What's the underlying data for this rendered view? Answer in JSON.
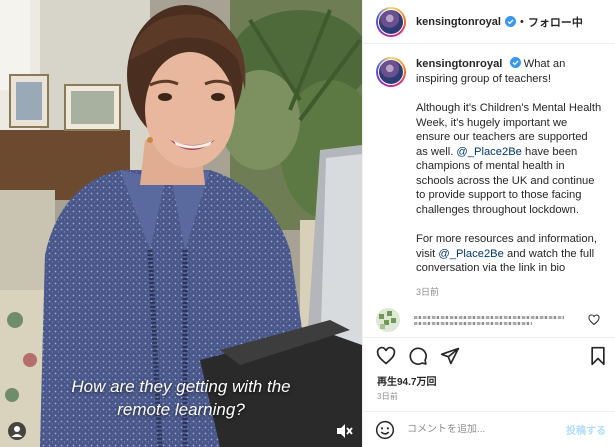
{
  "header": {
    "username": "kensingtonroyal",
    "separator": "•",
    "follow_label": "フォロー中"
  },
  "video": {
    "subtitle_line1": "How are they getting with the",
    "subtitle_line2": "remote learning?"
  },
  "caption": {
    "username": "kensingtonroyal",
    "intro": "What an inspiring group of teachers!",
    "para1_before": "Although it's Children's Mental Health Week, it's hugely important we ensure our teachers are supported as well.",
    "mention1": "@_Place2Be",
    "para1_after": "have been champions of mental health in schools across the UK and continue to provide support to those facing challenges throughout lockdown.",
    "para2_before": "For more resources and information, visit",
    "mention2": "@_Place2Be",
    "para2_after": "and watch the full conversation via the link in bio",
    "time_ago": "3日前"
  },
  "stats": {
    "views": "再生94.7万回",
    "date": "3日前"
  },
  "add_comment": {
    "placeholder": "コメントを追加...",
    "post_label": "投稿する"
  },
  "icons": {
    "like": "heart-icon",
    "comment": "comment-icon",
    "share": "share-icon",
    "save": "bookmark-icon",
    "emoji": "emoji-icon",
    "verified": "verified-badge-icon",
    "mute": "muted-speaker-icon",
    "user_tag": "user-tag-icon"
  },
  "colors": {
    "text": "#262626",
    "secondary": "#8e8e8e",
    "mention": "#00376b",
    "verified": "#3897f0",
    "post_disabled": "#b2dffc"
  }
}
